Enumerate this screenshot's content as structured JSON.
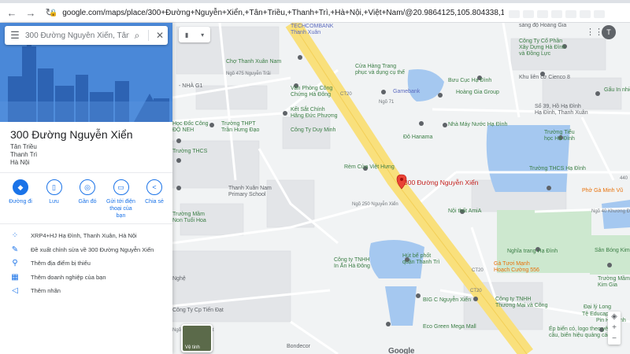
{
  "browser": {
    "url": "google.com/maps/place/300+Đường+Nguyễn+Xiển,+Tân+Triều,+Thanh+Trì,+Hà+Nội,+Việt+Nam/@20.9864125,105.804338,17z/data=!4m13!1m7!3m6!1s0x3135ac..."
  },
  "search": {
    "query": "300 Đường Nguyễn Xiển, Tân Tri"
  },
  "place": {
    "title": "300 Đường Nguyễn Xiển",
    "address_lines": [
      "Tân Triều",
      "Thanh Trì",
      "Hà Nội"
    ]
  },
  "actions": [
    {
      "label": "Đường đi",
      "icon": "directions-icon"
    },
    {
      "label": "Lưu",
      "icon": "bookmark-icon"
    },
    {
      "label": "Gần đó",
      "icon": "nearby-icon"
    },
    {
      "label": "Gửi tới điện thoại của bạn",
      "icon": "phone-send-icon"
    },
    {
      "label": "Chia sẻ",
      "icon": "share-icon"
    }
  ],
  "details": [
    {
      "text": "XRP4+HJ Hạ Đình, Thanh Xuân, Hà Nội",
      "icon": "plus-code-icon"
    },
    {
      "text": "Đề xuất chỉnh sửa về 300 Đường Nguyễn Xiển",
      "icon": "edit-icon"
    },
    {
      "text": "Thêm địa điểm bị thiếu",
      "icon": "add-place-icon"
    },
    {
      "text": "Thêm doanh nghiệp của bạn",
      "icon": "business-icon"
    },
    {
      "text": "Thêm nhãn",
      "icon": "label-icon"
    }
  ],
  "map": {
    "pin_label": "300 Đường Nguyễn Xiển",
    "layers_label": "Vệ tinh",
    "google_wordmark": "Google",
    "user_initial": "T",
    "labels": [
      {
        "text": "TECHCOMBANK",
        "cls": "biz"
      },
      {
        "text": "Thanh Xuân",
        "cls": "biz"
      },
      {
        "text": "Chợ Thanh Xuân Nam",
        "cls": "poi"
      },
      {
        "text": "Ngõ 475 Nguyễn Trãi",
        "cls": "road"
      },
      {
        "text": "- NHÀ G1",
        "cls": ""
      },
      {
        "text": "Văn Phòng Công",
        "cls": "poi"
      },
      {
        "text": "Chứng Hà Đông",
        "cls": "poi"
      },
      {
        "text": "Cửa Hàng Trang",
        "cls": "poi"
      },
      {
        "text": "phục và dụng cụ thể",
        "cls": "poi"
      },
      {
        "text": "Gamebank",
        "cls": "biz"
      },
      {
        "text": "Kết Sắt Chính",
        "cls": "poi"
      },
      {
        "text": "Hãng Đức Phương",
        "cls": "poi"
      },
      {
        "text": "Công Ty Duy Minh",
        "cls": "poi"
      },
      {
        "text": "Trường THPT",
        "cls": "poi"
      },
      {
        "text": "Trần Hưng Đạo",
        "cls": "poi"
      },
      {
        "text": "Học Đốc Công",
        "cls": "poi"
      },
      {
        "text": "ĐỘ NEH",
        "cls": "poi"
      },
      {
        "text": "Trường THCS",
        "cls": "poi"
      },
      {
        "text": "Thanh Xuân Nam",
        "cls": ""
      },
      {
        "text": "Primary School",
        "cls": ""
      },
      {
        "text": "Rèm Cửa Việt Hưng",
        "cls": "poi"
      },
      {
        "text": "Trường Mầm",
        "cls": "poi"
      },
      {
        "text": "Non Tuổi Hoa",
        "cls": "poi"
      },
      {
        "text": "Ngõ 250 Nguyễn Xiển",
        "cls": "road"
      },
      {
        "text": "Công ty TNHH",
        "cls": "poi"
      },
      {
        "text": "In Ấn Hà Đông",
        "cls": "poi"
      },
      {
        "text": "Hút bể phốt",
        "cls": "poi"
      },
      {
        "text": "quận Thanh Trì",
        "cls": "poi"
      },
      {
        "text": "BIG C Nguyễn Xiển",
        "cls": "poi"
      },
      {
        "text": "Eco Green Mega Mall",
        "cls": "poi"
      },
      {
        "text": "Bondecor",
        "cls": ""
      },
      {
        "text": "Công Ty Cp Tiến Đạt",
        "cls": ""
      },
      {
        "text": "Nghệ",
        "cls": ""
      },
      {
        "text": "sáng độ Hoàng Gia",
        "cls": ""
      },
      {
        "text": "Công Ty Cổ Phần",
        "cls": "poi"
      },
      {
        "text": "Xây Dựng Hà Đình",
        "cls": "poi"
      },
      {
        "text": "và Đồng Lực",
        "cls": "poi"
      },
      {
        "text": "Bưu Cục Hạ Đình",
        "cls": "poi"
      },
      {
        "text": "Hoàng Gia Group",
        "cls": "poi"
      },
      {
        "text": "Khu liên cơ Cienco 8",
        "cls": ""
      },
      {
        "text": "Gấu In nhiều loại",
        "cls": "poi"
      },
      {
        "text": "Sổ 39, Hồ Hạ Đình",
        "cls": ""
      },
      {
        "text": "Hạ Đình, Thanh Xuân",
        "cls": ""
      },
      {
        "text": "Đô Hanama",
        "cls": "poi"
      },
      {
        "text": "Nhà Máy Nước Hạ Đình",
        "cls": "poi"
      },
      {
        "text": "Trường Tiểu",
        "cls": "poi"
      },
      {
        "text": "học Hạ Đình",
        "cls": "poi"
      },
      {
        "text": "Trường THCS Hạ Đình",
        "cls": "poi"
      },
      {
        "text": "Phở Gà Minh Vũ",
        "cls": "food"
      },
      {
        "text": "Nội thất AmiA",
        "cls": "poi"
      },
      {
        "text": "Ngõ 40 Khương Đình",
        "cls": "road"
      },
      {
        "text": "Nghĩa trang Hạ Đình",
        "cls": "poi"
      },
      {
        "text": "Sân Bóng Kim",
        "cls": "poi"
      },
      {
        "text": "Gà Tươi Mạnh",
        "cls": "food"
      },
      {
        "text": "Hoạch Cường 556",
        "cls": "food"
      },
      {
        "text": "Trường Mầm",
        "cls": "poi"
      },
      {
        "text": "Kim Gia",
        "cls": "poi"
      },
      {
        "text": "Công ty TNHH",
        "cls": "poi"
      },
      {
        "text": "Thương Mại và Công",
        "cls": "poi"
      },
      {
        "text": "Tệ Educap",
        "cls": "poi"
      },
      {
        "text": "Đại lý Long",
        "cls": "poi"
      },
      {
        "text": "Pin Hà Đình",
        "cls": "poi"
      },
      {
        "text": "Ép biển có, logo theo yêu",
        "cls": "poi"
      },
      {
        "text": "cầu, biển hiệu quảng cáo",
        "cls": "poi"
      },
      {
        "text": "CT20",
        "cls": "road"
      },
      {
        "text": "CT20",
        "cls": "road"
      },
      {
        "text": "CT20",
        "cls": "road"
      },
      {
        "text": "Ngõ 71",
        "cls": "road"
      },
      {
        "text": "440",
        "cls": "road"
      },
      {
        "text": "Ngõ Vũ Hải đà phút",
        "cls": "road"
      }
    ]
  }
}
